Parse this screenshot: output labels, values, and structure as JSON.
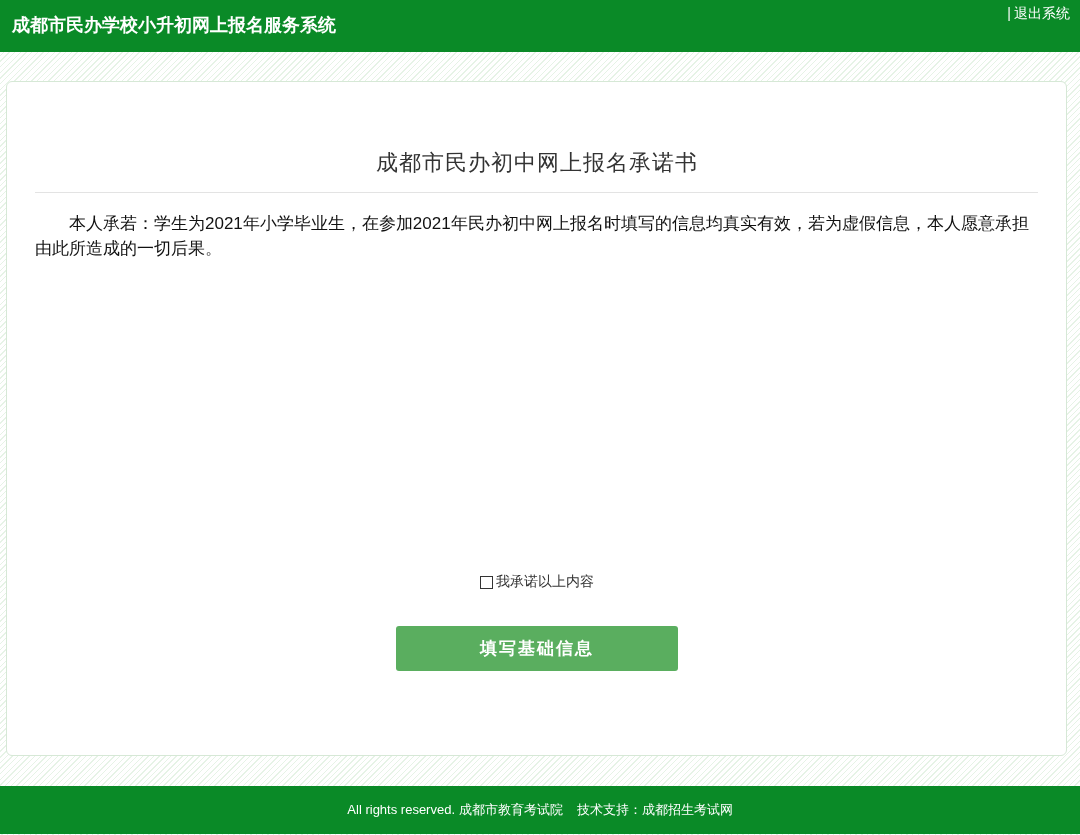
{
  "header": {
    "title": "成都市民办学校小升初网上报名服务系统",
    "separator": "|",
    "logout": "退出系统"
  },
  "pledge": {
    "title": "成都市民办初中网上报名承诺书",
    "text": "本人承若：学生为2021年小学毕业生，在参加2021年民办初中网上报名时填写的信息均真实有效，若为虚假信息，本人愿意承担由此所造成的一切后果。",
    "agree": {
      "label": "我承诺以上内容",
      "checked": false
    },
    "button": "填写基础信息"
  },
  "footer": [
    "All rights reserved. 成都市教育考试院",
    "技术支持：成都招生考试网"
  ]
}
